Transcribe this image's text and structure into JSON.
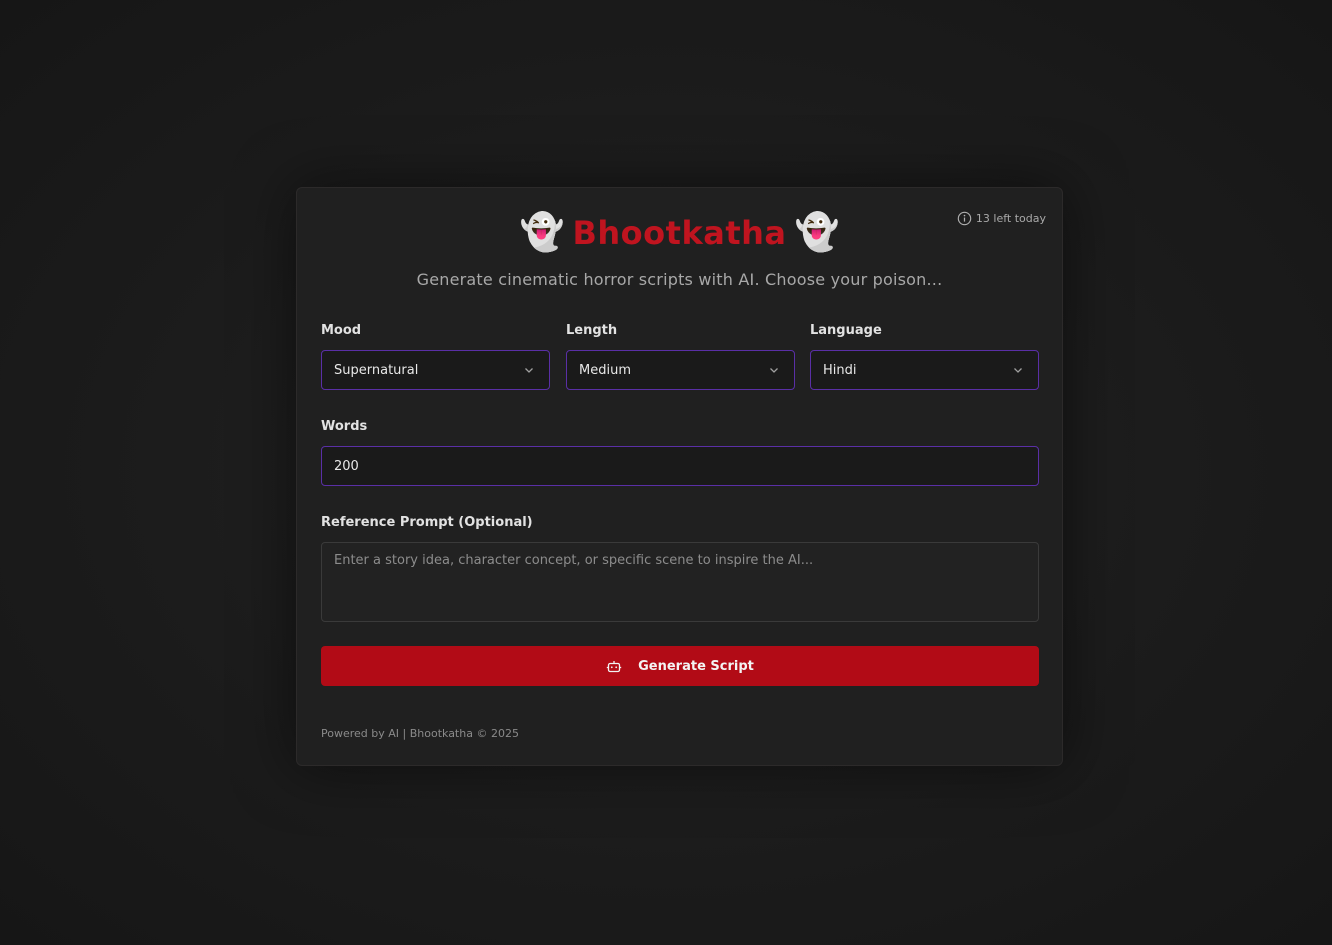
{
  "app": {
    "title": "Bhootkatha",
    "title_emoji": "👻",
    "subtitle": "Generate cinematic horror scripts with AI. Choose your poison...",
    "quota_text": "13 left today"
  },
  "form": {
    "mood": {
      "label": "Mood",
      "value": "Supernatural"
    },
    "length": {
      "label": "Length",
      "value": "Medium"
    },
    "language": {
      "label": "Language",
      "value": "Hindi"
    },
    "words": {
      "label": "Words",
      "value": "200"
    },
    "reference": {
      "label": "Reference Prompt (Optional)",
      "placeholder": "Enter a story idea, character concept, or specific scene to inspire the AI..."
    },
    "generate_label": "Generate Script"
  },
  "footer": {
    "text": "Powered by AI | Bhootkatha © 2025"
  },
  "colors": {
    "accent_red": "#c0141f",
    "button_red": "#b20b16",
    "focus_purple": "#5a2fa6"
  },
  "icons": {
    "quota": "info-circle-icon",
    "select": "chevron-down-icon",
    "generate": "robot-icon"
  }
}
